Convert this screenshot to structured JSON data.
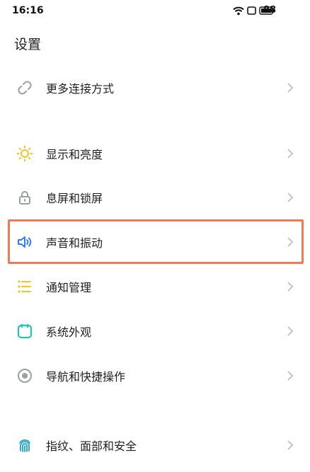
{
  "status_bar": {
    "time": "16:16",
    "battery": "88",
    "icons": [
      "wifi-icon",
      "notification-icon",
      "battery-icon"
    ]
  },
  "title": "设置",
  "items": [
    {
      "label": "更多连接方式",
      "icon": "link-icon",
      "color": "#9aa0a6"
    },
    {
      "label": "显示和亮度",
      "icon": "sun-icon",
      "color": "#f2c230"
    },
    {
      "label": "息屏和锁屏",
      "icon": "lock-icon",
      "color": "#9aa0a6"
    },
    {
      "label": "声音和振动",
      "icon": "speaker-icon",
      "color": "#2f7cf6",
      "highlighted": true
    },
    {
      "label": "通知管理",
      "icon": "list-icon",
      "color": "#f2c230"
    },
    {
      "label": "系统外观",
      "icon": "appearance-icon",
      "color": "#1fc7b5"
    },
    {
      "label": "导航和快捷操作",
      "icon": "navigation-icon",
      "color": "#9aa0a6"
    },
    {
      "label": "指纹、面部和安全",
      "icon": "fingerprint-icon",
      "color": "#1fa3c9"
    }
  ],
  "colors": {
    "highlight_border": "#ef7a57",
    "chevron": "#c4c4c4"
  }
}
